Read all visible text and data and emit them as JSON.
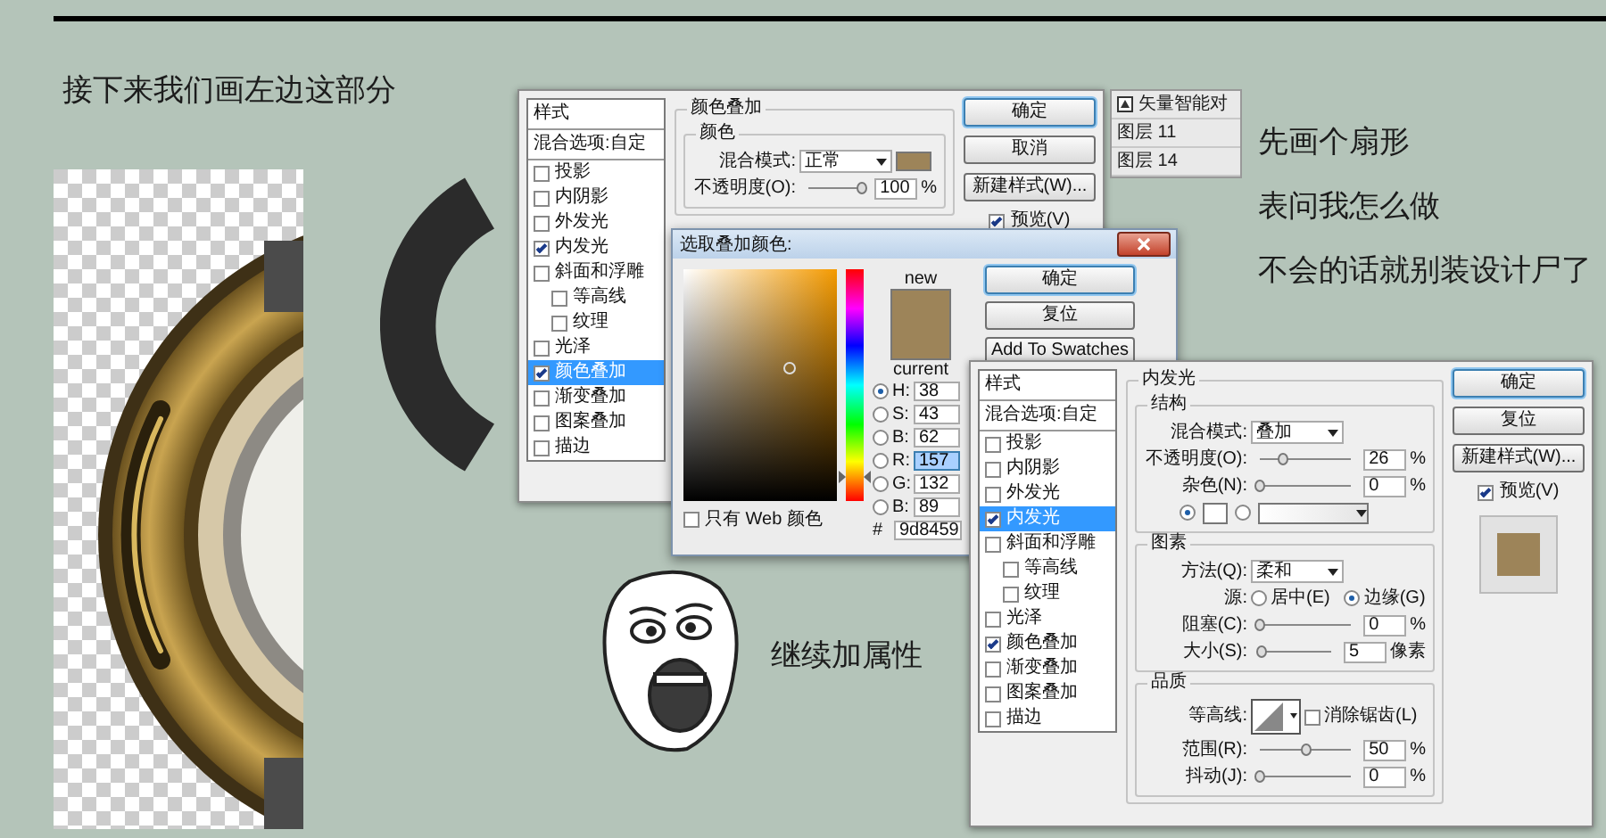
{
  "heading": "接下来我们画左边这部分",
  "notes": [
    "先画个扇形",
    "表问我怎么做",
    "不会的话就别装设计尸了"
  ],
  "caption": "继续加属性",
  "color_overlay_dialog": {
    "styles": {
      "header": "样式",
      "blending": "混合选项:自定",
      "effects": [
        {
          "label": "投影",
          "checked": false,
          "selected": false
        },
        {
          "label": "内阴影",
          "checked": false,
          "selected": false
        },
        {
          "label": "外发光",
          "checked": false,
          "selected": false
        },
        {
          "label": "内发光",
          "checked": true,
          "selected": false
        },
        {
          "label": "斜面和浮雕",
          "checked": false,
          "selected": false,
          "children": [
            {
              "label": "等高线",
              "checked": false,
              "selected": false
            },
            {
              "label": "纹理",
              "checked": false,
              "selected": false
            }
          ]
        },
        {
          "label": "光泽",
          "checked": false,
          "selected": false
        },
        {
          "label": "颜色叠加",
          "checked": true,
          "selected": true
        },
        {
          "label": "渐变叠加",
          "checked": false,
          "selected": false
        },
        {
          "label": "图案叠加",
          "checked": false,
          "selected": false
        },
        {
          "label": "描边",
          "checked": false,
          "selected": false
        }
      ]
    },
    "section_title": "颜色叠加",
    "group_title": "颜色",
    "blend_label": "混合模式:",
    "blend_value": "正常",
    "opacity": {
      "label": "不透明度(O):",
      "level": 1,
      "value": "100",
      "unit": "%"
    },
    "buttons": [
      {
        "label": "确定",
        "default": true
      },
      {
        "label": "取消",
        "default": false
      },
      {
        "label": "新建样式(W)...",
        "default": false
      }
    ],
    "preview": {
      "label": "预览(V)",
      "checked": true
    }
  },
  "layers": [
    {
      "name": "矢量智能对",
      "kind": "smart-object"
    },
    {
      "name": "图层 11",
      "kind": "layer"
    },
    {
      "name": "图层 14",
      "kind": "layer"
    }
  ],
  "color_picker": {
    "title": "选取叠加颜色:",
    "new_label": "new",
    "current_label": "current",
    "hue": {
      "level": 0.1
    },
    "fields": [
      {
        "label": "H:",
        "value": "38",
        "selected": true,
        "focused": false
      },
      {
        "label": "S:",
        "value": "43",
        "selected": false,
        "focused": false
      },
      {
        "label": "B:",
        "value": "62",
        "selected": false,
        "focused": false
      },
      {
        "label": "R:",
        "value": "157",
        "selected": false,
        "focused": true
      },
      {
        "label": "G:",
        "value": "132",
        "selected": false,
        "focused": false
      },
      {
        "label": "B:",
        "value": "89",
        "selected": false,
        "focused": false
      }
    ],
    "hex_label": "#",
    "hex_value": "9d8459",
    "web_only": {
      "label": "只有 Web 颜色",
      "checked": false
    },
    "buttons": [
      {
        "label": "确定",
        "default": true
      },
      {
        "label": "复位",
        "default": false
      },
      {
        "label": "Add To Swatches",
        "default": false
      }
    ]
  },
  "inner_glow_dialog": {
    "styles": {
      "header": "样式",
      "blending": "混合选项:自定",
      "effects": [
        {
          "label": "投影",
          "checked": false,
          "selected": false
        },
        {
          "label": "内阴影",
          "checked": false,
          "selected": false
        },
        {
          "label": "外发光",
          "checked": false,
          "selected": false
        },
        {
          "label": "内发光",
          "checked": true,
          "selected": true
        },
        {
          "label": "斜面和浮雕",
          "checked": false,
          "selected": false,
          "children": [
            {
              "label": "等高线",
              "checked": false,
              "selected": false
            },
            {
              "label": "纹理",
              "checked": false,
              "selected": false
            }
          ]
        },
        {
          "label": "光泽",
          "checked": false,
          "selected": false
        },
        {
          "label": "颜色叠加",
          "checked": true,
          "selected": false
        },
        {
          "label": "渐变叠加",
          "checked": false,
          "selected": false
        },
        {
          "label": "图案叠加",
          "checked": false,
          "selected": false
        },
        {
          "label": "描边",
          "checked": false,
          "selected": false
        }
      ]
    },
    "section_title": "内发光",
    "structure": {
      "title": "结构",
      "blend_label": "混合模式:",
      "blend_value": "叠加",
      "opacity": {
        "label": "不透明度(O):",
        "level": 0.26,
        "value": "26",
        "unit": "%"
      },
      "noise": {
        "label": "杂色(N):",
        "level": 0,
        "value": "0",
        "unit": "%"
      },
      "fill_options": [
        {
          "kind": "color",
          "selected": true
        },
        {
          "kind": "gradient",
          "selected": false
        }
      ]
    },
    "elements": {
      "title": "图素",
      "technique_label": "方法(Q):",
      "technique_value": "柔和",
      "source_label": "源:",
      "sources": [
        {
          "label": "居中(E)",
          "selected": false
        },
        {
          "label": "边缘(G)",
          "selected": true
        }
      ],
      "choke": {
        "label": "阻塞(C):",
        "level": 0,
        "value": "0",
        "unit": "%"
      },
      "size": {
        "label": "大小(S):",
        "level": 0.02,
        "value": "5",
        "unit": "像素"
      }
    },
    "quality": {
      "title": "品质",
      "contour_label": "等高线:",
      "anti_alias": {
        "label": "消除锯齿(L)",
        "checked": false
      },
      "range": {
        "label": "范围(R):",
        "level": 0.5,
        "value": "50",
        "unit": "%"
      },
      "jitter": {
        "label": "抖动(J):",
        "level": 0,
        "value": "0",
        "unit": "%"
      }
    },
    "buttons": [
      {
        "label": "确定",
        "default": true
      },
      {
        "label": "复位",
        "default": false
      },
      {
        "label": "新建样式(W)...",
        "default": false
      }
    ],
    "preview": {
      "label": "预览(V)",
      "checked": true
    }
  }
}
